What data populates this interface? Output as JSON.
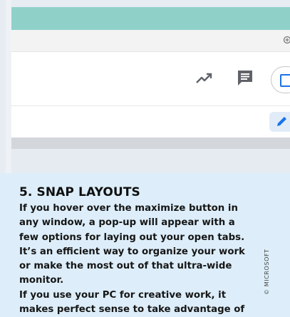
{
  "article": {
    "heading": "5. SNAP LAYOUTS",
    "paragraph1": "If you hover over the maximize button in any window, a pop-up will appear with a few options for laying out your open tabs. It’s an efficient way to organize your work or make the most out of that ultra-wide monitor.",
    "paragraph2": "If you use your PC for creative work, it makes perfect sense to take advantage of"
  },
  "credit": "© MICROSOFT",
  "icons": {
    "zoom": "zoom-in-icon",
    "trend": "trending-up-icon",
    "comment": "comment-icon",
    "present": "present-icon",
    "edit": "pencil-icon"
  },
  "colors": {
    "page_background": "#ddeefa",
    "teal_band": "#8fd1c9",
    "accent_blue": "#1a73e8",
    "icon_gray": "#5f6368"
  }
}
